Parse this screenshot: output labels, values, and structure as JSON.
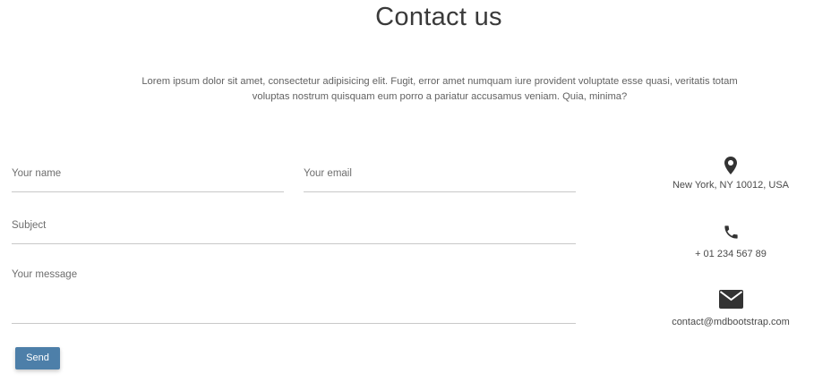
{
  "header": {
    "title": "Contact us",
    "intro": "Lorem ipsum dolor sit amet, consectetur adipisicing elit. Fugit, error amet numquam iure provident voluptate esse quasi, veritatis totam voluptas nostrum quisquam eum porro a pariatur accusamus veniam. Quia, minima?"
  },
  "form": {
    "name_placeholder": "Your name",
    "email_placeholder": "Your email",
    "subject_placeholder": "Subject",
    "message_placeholder": "Your message",
    "send_label": "Send"
  },
  "contact": {
    "address": "New York, NY 10012, USA",
    "phone": "+ 01 234 567 89",
    "email": "contact@mdbootstrap.com"
  },
  "icons": {
    "address": "map-marker-icon",
    "phone": "phone-icon",
    "email": "envelope-icon"
  },
  "colors": {
    "button": "#4d7fa9",
    "icon": "#333333"
  }
}
